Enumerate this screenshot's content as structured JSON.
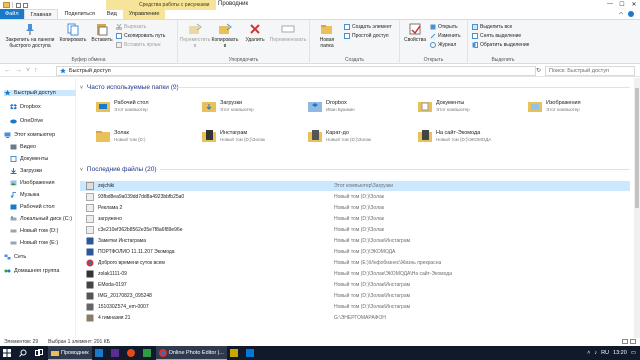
{
  "titlebar": {
    "context_tab": "Средства работы с рисунками",
    "window_title": "Проводник",
    "min": "—",
    "max": "☐",
    "close": "✕"
  },
  "tabs": {
    "file": "Файл",
    "home": "Главная",
    "share": "Поделиться",
    "view": "Вид",
    "manage": "Управление"
  },
  "ribbon": {
    "clipboard": {
      "pin": "Закрепить на панели быстрого доступа",
      "copy": "Копировать",
      "paste": "Вставить",
      "cut": "Вырезать",
      "copy_path": "Скопировать путь",
      "paste_shortcut": "Вставить ярлык",
      "label": "Буфер обмена"
    },
    "organize": {
      "move_to": "Переместить в",
      "copy_to": "Копировать в",
      "delete": "Удалить",
      "rename": "Переименовать",
      "label": "Упорядочить"
    },
    "new": {
      "new_folder": "Новая папка",
      "new_item": "Создать элемент",
      "easy_access": "Простой доступ",
      "label": "Создать"
    },
    "open": {
      "properties": "Свойства",
      "open": "Открыть",
      "edit": "Изменить",
      "history": "Журнал",
      "label": "Открыть"
    },
    "select": {
      "select_all": "Выделить все",
      "select_none": "Снять выделение",
      "invert": "Обратить выделение",
      "label": "Выделить"
    }
  },
  "address": {
    "path": "Быстрый доступ",
    "search_placeholder": "Поиск: Быстрый доступ"
  },
  "nav": [
    "Быстрый доступ",
    "Dropbox",
    "OneDrive",
    "Этот компьютер",
    "Видео",
    "Документы",
    "Загрузки",
    "Изображения",
    "Музыка",
    "Рабочий стол",
    "Локальный диск (C:)",
    "Новый том (D:)",
    "Новый том (E:)",
    "Сеть",
    "Домашняя группа"
  ],
  "frequent": {
    "header": "Часто используемые папки (9)",
    "items": [
      {
        "name": "Рабочий стол",
        "sub": "Этот компьютер"
      },
      {
        "name": "Загрузки",
        "sub": "Этот компьютер"
      },
      {
        "name": "Dropbox",
        "sub": "Иван Бушмин"
      },
      {
        "name": "Документы",
        "sub": "Этот компьютер"
      },
      {
        "name": "Изображения",
        "sub": "Этот компьютер"
      },
      {
        "name": "Золак",
        "sub": "Новый том (D:)"
      },
      {
        "name": "Инстаграм",
        "sub": "Новый том (D:)\\Золак"
      },
      {
        "name": "Карат-до",
        "sub": "Новый том (D:)\\Золак"
      },
      {
        "name": "На сайт-Экомода",
        "sub": "Новый том (D:)\\ЭКОМОДА"
      }
    ]
  },
  "recent": {
    "header": "Последние файлы (20)",
    "items": [
      {
        "name": "zejchiki",
        "loc": "Этот компьютер\\Загрузки"
      },
      {
        "name": "93fbd8ea9a039dd7dd8a4923bbfb25a0",
        "loc": "Новый том (D:)\\Золак"
      },
      {
        "name": "Реклама 2",
        "loc": "Новый том (D:)\\Золак"
      },
      {
        "name": "загружено",
        "loc": "Новый том (D:)\\Золак"
      },
      {
        "name": "c3e210ef362b8562e35e7f8a6f89e96e",
        "loc": "Новый том (D:)\\Золак"
      },
      {
        "name": "Заметки Инстаграма",
        "loc": "Новый том (D:)\\Золак\\Инстаграм"
      },
      {
        "name": "ПОРТФОЛИО 11.11.207 Экомода",
        "loc": "Новый том (D:)\\ЭКОМОДА"
      },
      {
        "name": "Доброго времени суток всем",
        "loc": "Новый том (E:)\\Инфобизнес\\Жизнь прекрасна"
      },
      {
        "name": "zolak1111-09",
        "loc": "Новый том (D:)\\Золак\\ЭКОМОДА\\На сайт-Экомода"
      },
      {
        "name": "EModa-0197",
        "loc": "Новый том (D:)\\Золак\\Инстаграм"
      },
      {
        "name": "IMG_20170823_095248",
        "loc": "Новый том (D:)\\Золак\\Инстаграм"
      },
      {
        "name": "151030Z574_em-0007",
        "loc": "Новый том (D:)\\Золак\\Инстаграм"
      },
      {
        "name": "4 гимназия 21",
        "loc": "G:\\ЭНЕРГОМАРАФОН"
      }
    ]
  },
  "status": {
    "count": "Элементов: 29",
    "selected": "Выбран 1 элемент: 201 КБ"
  },
  "taskbar": {
    "explorer": "Проводник",
    "editor": "Online Photo Editor |...",
    "clock": "13:20",
    "lang": "RU"
  },
  "colors": {
    "accent": "#1979ca",
    "context_tab": "#f5e49a",
    "selection": "#cce8ff",
    "taskbar": "#101a2b"
  }
}
